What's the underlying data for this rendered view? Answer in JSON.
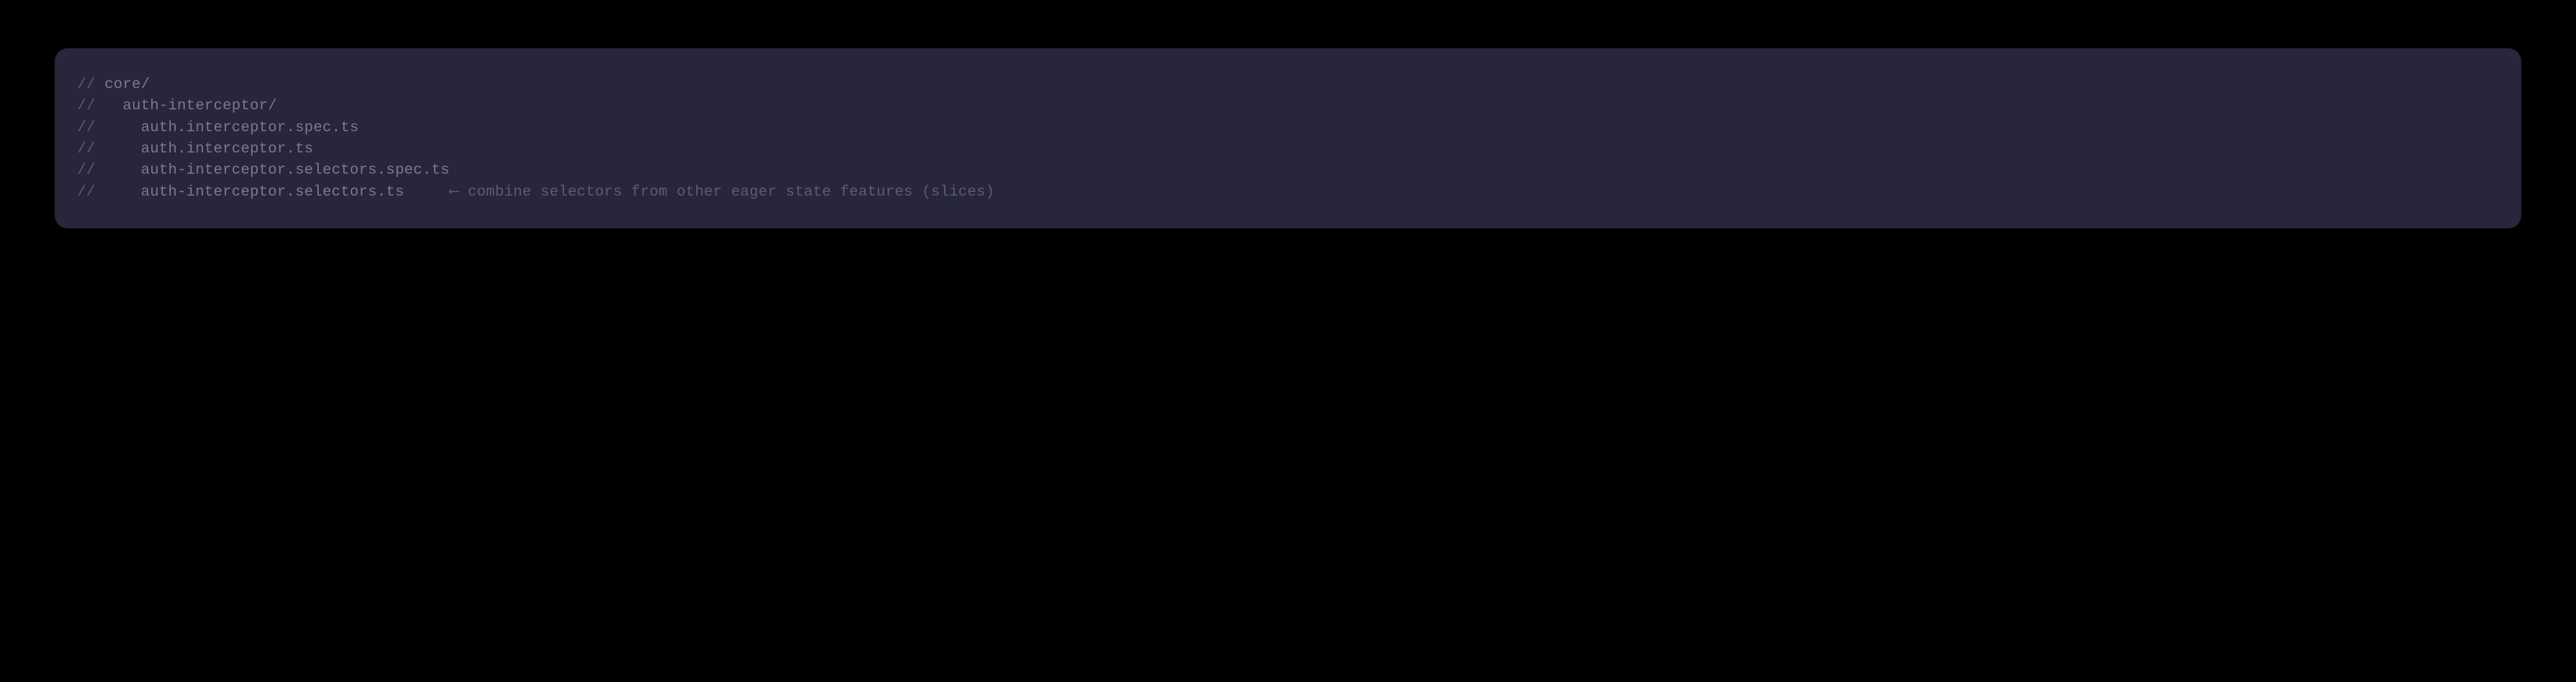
{
  "code": {
    "lines": [
      {
        "prefix": "// ",
        "content": "core/",
        "arrow": "",
        "annotation": ""
      },
      {
        "prefix": "//   ",
        "content": "auth-interceptor/",
        "arrow": "",
        "annotation": ""
      },
      {
        "prefix": "//     ",
        "content": "auth.interceptor.spec.ts",
        "arrow": "",
        "annotation": ""
      },
      {
        "prefix": "//     ",
        "content": "auth.interceptor.ts",
        "arrow": "",
        "annotation": ""
      },
      {
        "prefix": "//     ",
        "content": "auth-interceptor.selectors.spec.ts",
        "arrow": "",
        "annotation": ""
      },
      {
        "prefix": "//     ",
        "content": "auth-interceptor.selectors.ts",
        "arrow": "     ⟵ ",
        "annotation": "combine selectors from other eager state features (slices)"
      }
    ]
  }
}
